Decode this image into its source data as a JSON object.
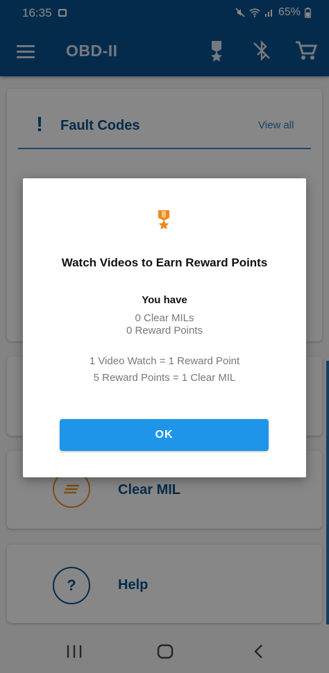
{
  "status_bar": {
    "time": "16:35",
    "battery": "65%",
    "icons": [
      "image-icon",
      "mute-icon",
      "wifi-icon",
      "signal-icon",
      "battery-icon"
    ]
  },
  "app_bar": {
    "title": "OBD-II",
    "icons": [
      "menu-icon",
      "medal-icon",
      "bluetooth-disabled-icon",
      "cart-icon"
    ]
  },
  "cards": {
    "fault_codes": {
      "title": "Fault Codes",
      "link": "View all",
      "icon": "exclamation-icon"
    },
    "clear_mil": {
      "label": "Clear MIL",
      "icon": "clear-lines-icon"
    },
    "help": {
      "label": "Help",
      "icon_text": "?"
    }
  },
  "dialog": {
    "title": "Watch Videos to Earn Reward Points",
    "you_have": "You have",
    "clear_mils": "0 Clear MILs",
    "reward_points": "0 Reward Points",
    "rule_1": "1 Video Watch = 1 Reward Point",
    "rule_2": "5 Reward Points = 1 Clear MIL",
    "ok_label": "OK",
    "icon": "medal-icon"
  },
  "nav_bar": {
    "icons": [
      "recent-apps-icon",
      "home-icon",
      "back-icon"
    ]
  },
  "colors": {
    "app_bar": "#0a4f8a",
    "accent_button": "#1e95e8",
    "medal": "#e98a22",
    "link": "#2c77b8"
  }
}
